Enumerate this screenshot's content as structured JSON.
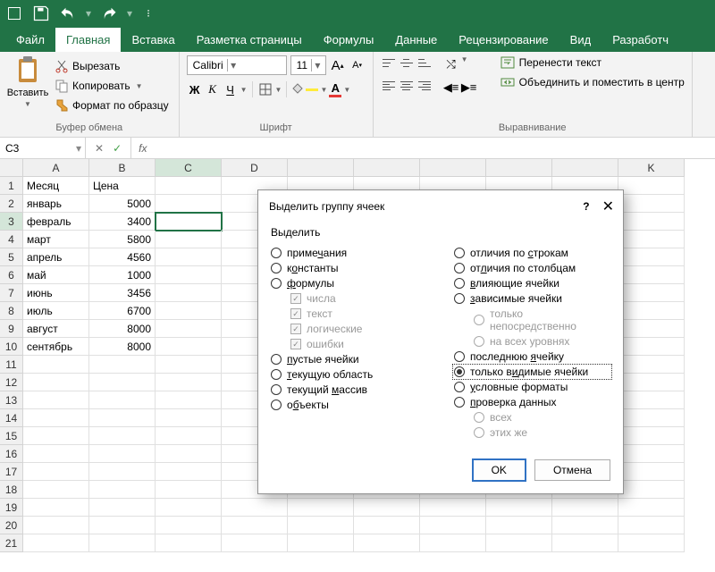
{
  "titlebar": {
    "save": "save",
    "undo": "undo",
    "redo": "redo"
  },
  "tabs": {
    "file": "Файл",
    "home": "Главная",
    "insert": "Вставка",
    "layout": "Разметка страницы",
    "formulas": "Формулы",
    "data": "Данные",
    "review": "Рецензирование",
    "view": "Вид",
    "dev": "Разработч"
  },
  "ribbon": {
    "paste": "Вставить",
    "cut": "Вырезать",
    "copy": "Копировать",
    "format": "Формат по образцу",
    "clipboard_group": "Буфер обмена",
    "font_name": "Calibri",
    "font_size": "11",
    "font_group": "Шрифт",
    "wrap": "Перенести текст",
    "merge": "Объединить и поместить в центр",
    "align_group": "Выравнивание"
  },
  "namebox": "C3",
  "cols": [
    "A",
    "B",
    "C",
    "D",
    "",
    "",
    "",
    "",
    "",
    "K"
  ],
  "rows": [
    "1",
    "2",
    "3",
    "4",
    "5",
    "6",
    "7",
    "8",
    "9",
    "10",
    "11",
    "12",
    "13",
    "14",
    "15",
    "16",
    "17",
    "18",
    "19",
    "20",
    "21"
  ],
  "sheet": {
    "A": [
      "Месяц",
      "январь",
      "февраль",
      "март",
      "апрель",
      "май",
      "июнь",
      "июль",
      "август",
      "сентябрь"
    ],
    "B_header": "Цена",
    "B": [
      5000,
      3400,
      5800,
      4560,
      1000,
      3456,
      6700,
      8000,
      8000
    ]
  },
  "chart_data": {
    "type": "table",
    "categories": [
      "январь",
      "февраль",
      "март",
      "апрель",
      "май",
      "июнь",
      "июль",
      "август",
      "сентябрь"
    ],
    "values": [
      5000,
      3400,
      5800,
      4560,
      1000,
      3456,
      6700,
      8000,
      8000
    ],
    "xlabel": "Месяц",
    "ylabel": "Цена"
  },
  "dialog": {
    "title": "Выделить группу ячеек",
    "group_label": "Выделить",
    "comments": "примечания",
    "constants": "константы",
    "formulas": "формулы",
    "numbers": "числа",
    "text": "текст",
    "logicals": "логические",
    "errors": "ошибки",
    "blanks": "пустые ячейки",
    "region": "текущую область",
    "array": "текущий массив",
    "objects": "объекты",
    "row_diff": "отличия по строкам",
    "col_diff": "отличия по столбцам",
    "precedents": "влияющие ячейки",
    "dependents": "зависимые ячейки",
    "direct": "только непосредственно",
    "all_levels": "на всех уровнях",
    "last": "последнюю ячейку",
    "visible": "только видимые ячейки",
    "cond": "условные форматы",
    "validation": "проверка данных",
    "all": "всех",
    "same": "этих же",
    "ok": "OK",
    "cancel": "Отмена",
    "underline": {
      "comments": "ч",
      "constants": "о",
      "formulas": "ф",
      "blanks": "п",
      "region": "т",
      "array": "м",
      "objects": "б",
      "row_diff": "с",
      "col_diff": "л",
      "precedents": "в",
      "dependents": "з",
      "last": "я",
      "visible": "и",
      "cond": "у",
      "validation": "п"
    }
  }
}
